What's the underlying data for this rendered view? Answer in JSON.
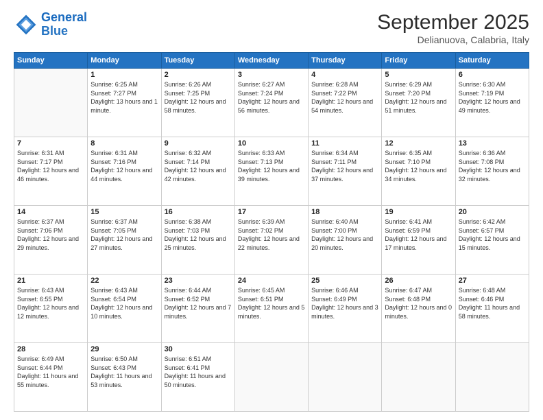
{
  "logo": {
    "line1": "General",
    "line2": "Blue"
  },
  "header": {
    "month": "September 2025",
    "location": "Delianuova, Calabria, Italy"
  },
  "days_of_week": [
    "Sunday",
    "Monday",
    "Tuesday",
    "Wednesday",
    "Thursday",
    "Friday",
    "Saturday"
  ],
  "weeks": [
    [
      {
        "num": "",
        "sunrise": "",
        "sunset": "",
        "daylight": ""
      },
      {
        "num": "1",
        "sunrise": "Sunrise: 6:25 AM",
        "sunset": "Sunset: 7:27 PM",
        "daylight": "Daylight: 13 hours and 1 minute."
      },
      {
        "num": "2",
        "sunrise": "Sunrise: 6:26 AM",
        "sunset": "Sunset: 7:25 PM",
        "daylight": "Daylight: 12 hours and 58 minutes."
      },
      {
        "num": "3",
        "sunrise": "Sunrise: 6:27 AM",
        "sunset": "Sunset: 7:24 PM",
        "daylight": "Daylight: 12 hours and 56 minutes."
      },
      {
        "num": "4",
        "sunrise": "Sunrise: 6:28 AM",
        "sunset": "Sunset: 7:22 PM",
        "daylight": "Daylight: 12 hours and 54 minutes."
      },
      {
        "num": "5",
        "sunrise": "Sunrise: 6:29 AM",
        "sunset": "Sunset: 7:20 PM",
        "daylight": "Daylight: 12 hours and 51 minutes."
      },
      {
        "num": "6",
        "sunrise": "Sunrise: 6:30 AM",
        "sunset": "Sunset: 7:19 PM",
        "daylight": "Daylight: 12 hours and 49 minutes."
      }
    ],
    [
      {
        "num": "7",
        "sunrise": "Sunrise: 6:31 AM",
        "sunset": "Sunset: 7:17 PM",
        "daylight": "Daylight: 12 hours and 46 minutes."
      },
      {
        "num": "8",
        "sunrise": "Sunrise: 6:31 AM",
        "sunset": "Sunset: 7:16 PM",
        "daylight": "Daylight: 12 hours and 44 minutes."
      },
      {
        "num": "9",
        "sunrise": "Sunrise: 6:32 AM",
        "sunset": "Sunset: 7:14 PM",
        "daylight": "Daylight: 12 hours and 42 minutes."
      },
      {
        "num": "10",
        "sunrise": "Sunrise: 6:33 AM",
        "sunset": "Sunset: 7:13 PM",
        "daylight": "Daylight: 12 hours and 39 minutes."
      },
      {
        "num": "11",
        "sunrise": "Sunrise: 6:34 AM",
        "sunset": "Sunset: 7:11 PM",
        "daylight": "Daylight: 12 hours and 37 minutes."
      },
      {
        "num": "12",
        "sunrise": "Sunrise: 6:35 AM",
        "sunset": "Sunset: 7:10 PM",
        "daylight": "Daylight: 12 hours and 34 minutes."
      },
      {
        "num": "13",
        "sunrise": "Sunrise: 6:36 AM",
        "sunset": "Sunset: 7:08 PM",
        "daylight": "Daylight: 12 hours and 32 minutes."
      }
    ],
    [
      {
        "num": "14",
        "sunrise": "Sunrise: 6:37 AM",
        "sunset": "Sunset: 7:06 PM",
        "daylight": "Daylight: 12 hours and 29 minutes."
      },
      {
        "num": "15",
        "sunrise": "Sunrise: 6:37 AM",
        "sunset": "Sunset: 7:05 PM",
        "daylight": "Daylight: 12 hours and 27 minutes."
      },
      {
        "num": "16",
        "sunrise": "Sunrise: 6:38 AM",
        "sunset": "Sunset: 7:03 PM",
        "daylight": "Daylight: 12 hours and 25 minutes."
      },
      {
        "num": "17",
        "sunrise": "Sunrise: 6:39 AM",
        "sunset": "Sunset: 7:02 PM",
        "daylight": "Daylight: 12 hours and 22 minutes."
      },
      {
        "num": "18",
        "sunrise": "Sunrise: 6:40 AM",
        "sunset": "Sunset: 7:00 PM",
        "daylight": "Daylight: 12 hours and 20 minutes."
      },
      {
        "num": "19",
        "sunrise": "Sunrise: 6:41 AM",
        "sunset": "Sunset: 6:59 PM",
        "daylight": "Daylight: 12 hours and 17 minutes."
      },
      {
        "num": "20",
        "sunrise": "Sunrise: 6:42 AM",
        "sunset": "Sunset: 6:57 PM",
        "daylight": "Daylight: 12 hours and 15 minutes."
      }
    ],
    [
      {
        "num": "21",
        "sunrise": "Sunrise: 6:43 AM",
        "sunset": "Sunset: 6:55 PM",
        "daylight": "Daylight: 12 hours and 12 minutes."
      },
      {
        "num": "22",
        "sunrise": "Sunrise: 6:43 AM",
        "sunset": "Sunset: 6:54 PM",
        "daylight": "Daylight: 12 hours and 10 minutes."
      },
      {
        "num": "23",
        "sunrise": "Sunrise: 6:44 AM",
        "sunset": "Sunset: 6:52 PM",
        "daylight": "Daylight: 12 hours and 7 minutes."
      },
      {
        "num": "24",
        "sunrise": "Sunrise: 6:45 AM",
        "sunset": "Sunset: 6:51 PM",
        "daylight": "Daylight: 12 hours and 5 minutes."
      },
      {
        "num": "25",
        "sunrise": "Sunrise: 6:46 AM",
        "sunset": "Sunset: 6:49 PM",
        "daylight": "Daylight: 12 hours and 3 minutes."
      },
      {
        "num": "26",
        "sunrise": "Sunrise: 6:47 AM",
        "sunset": "Sunset: 6:48 PM",
        "daylight": "Daylight: 12 hours and 0 minutes."
      },
      {
        "num": "27",
        "sunrise": "Sunrise: 6:48 AM",
        "sunset": "Sunset: 6:46 PM",
        "daylight": "Daylight: 11 hours and 58 minutes."
      }
    ],
    [
      {
        "num": "28",
        "sunrise": "Sunrise: 6:49 AM",
        "sunset": "Sunset: 6:44 PM",
        "daylight": "Daylight: 11 hours and 55 minutes."
      },
      {
        "num": "29",
        "sunrise": "Sunrise: 6:50 AM",
        "sunset": "Sunset: 6:43 PM",
        "daylight": "Daylight: 11 hours and 53 minutes."
      },
      {
        "num": "30",
        "sunrise": "Sunrise: 6:51 AM",
        "sunset": "Sunset: 6:41 PM",
        "daylight": "Daylight: 11 hours and 50 minutes."
      },
      {
        "num": "",
        "sunrise": "",
        "sunset": "",
        "daylight": ""
      },
      {
        "num": "",
        "sunrise": "",
        "sunset": "",
        "daylight": ""
      },
      {
        "num": "",
        "sunrise": "",
        "sunset": "",
        "daylight": ""
      },
      {
        "num": "",
        "sunrise": "",
        "sunset": "",
        "daylight": ""
      }
    ]
  ]
}
